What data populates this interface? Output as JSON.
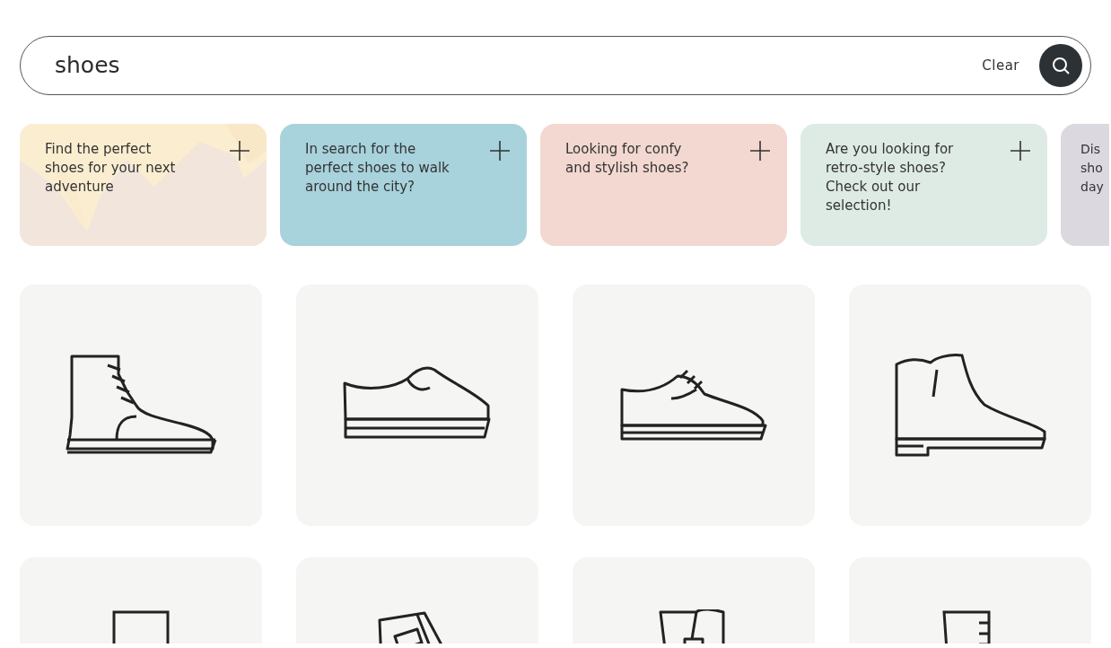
{
  "search": {
    "value": "shoes",
    "clear_label": "Clear"
  },
  "suggestions": [
    {
      "lines": [
        "Find the perfect",
        "shoes for your next",
        "adventure"
      ],
      "color": "#f2e6dc",
      "kind": "picture"
    },
    {
      "lines": [
        "In search for the",
        "perfect shoes to walk",
        "around the city?"
      ],
      "color": "#a8d2dc",
      "kind": "plain"
    },
    {
      "lines": [
        "Looking for confy",
        "and stylish shoes?"
      ],
      "color": "#f2d8d0",
      "kind": "plain"
    },
    {
      "lines": [
        "Are you looking for",
        "retro-style shoes?",
        "Check out our",
        "selection!"
      ],
      "color": "#deebe4",
      "kind": "plain"
    },
    {
      "lines": [
        "Dis",
        "sho",
        "day"
      ],
      "color": "#dcd8e0",
      "kind": "cut"
    }
  ],
  "products": [
    {
      "kind": "ankle-boot"
    },
    {
      "kind": "slip-on"
    },
    {
      "kind": "oxford"
    },
    {
      "kind": "chelsea"
    },
    {
      "kind": "tall-boot"
    },
    {
      "kind": "folded-boot"
    },
    {
      "kind": "cuff-boot"
    },
    {
      "kind": "laced-boot"
    }
  ]
}
